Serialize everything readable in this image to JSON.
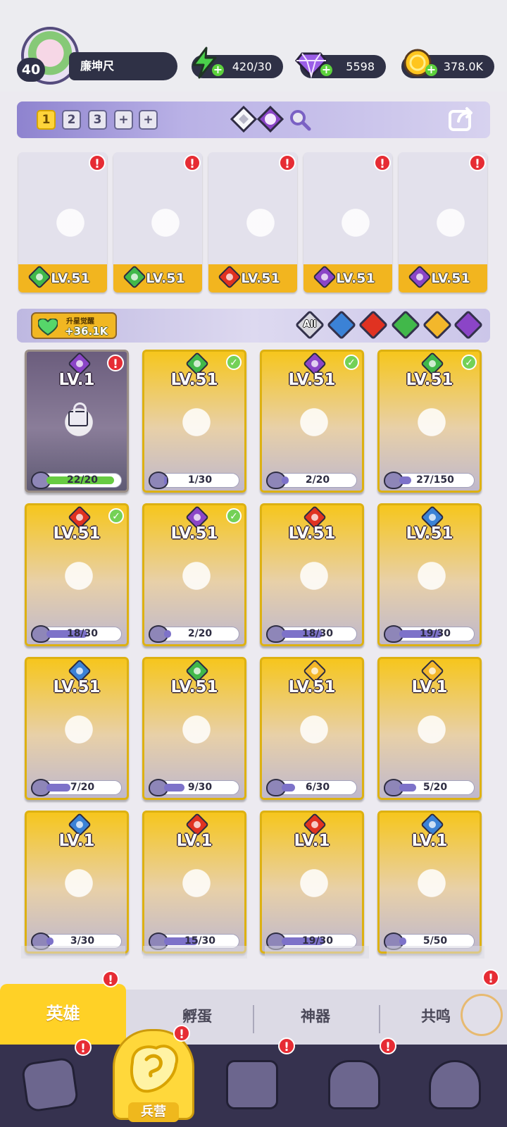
{
  "profile": {
    "level": "40",
    "name": "廉坤尺"
  },
  "resources": {
    "energy": "420/30",
    "gems": "5598",
    "coins": "378.0K"
  },
  "team": {
    "tabs": [
      "1",
      "2",
      "3",
      "+",
      "+"
    ],
    "active": "1"
  },
  "team_slots": [
    {
      "level": "LV.51",
      "element": "nature"
    },
    {
      "level": "LV.51",
      "element": "nature"
    },
    {
      "level": "LV.51",
      "element": "fire"
    },
    {
      "level": "LV.51",
      "element": "dark"
    },
    {
      "level": "LV.51",
      "element": "dark"
    }
  ],
  "awakening": {
    "title": "升星觉醒",
    "value": "+36.1K"
  },
  "filters": {
    "all": "All",
    "elements": [
      "water",
      "fire",
      "nature",
      "light",
      "dark"
    ]
  },
  "heroes": [
    {
      "level": "LV.1",
      "progress": "22/20",
      "fill": 1.0,
      "element": "dark",
      "locked": true,
      "alert": true,
      "check": false
    },
    {
      "level": "LV.51",
      "progress": "1/30",
      "fill": 0.03,
      "element": "nature",
      "locked": false,
      "alert": false,
      "check": true
    },
    {
      "level": "LV.51",
      "progress": "2/20",
      "fill": 0.1,
      "element": "dark",
      "locked": false,
      "alert": false,
      "check": true
    },
    {
      "level": "LV.51",
      "progress": "27/150",
      "fill": 0.18,
      "element": "nature",
      "locked": false,
      "alert": false,
      "check": true
    },
    {
      "level": "LV.51",
      "progress": "18/30",
      "fill": 0.6,
      "element": "fire",
      "locked": false,
      "alert": false,
      "check": true
    },
    {
      "level": "LV.51",
      "progress": "2/20",
      "fill": 0.1,
      "element": "dark",
      "locked": false,
      "alert": false,
      "check": true
    },
    {
      "level": "LV.51",
      "progress": "18/30",
      "fill": 0.6,
      "element": "fire",
      "locked": false,
      "alert": false,
      "check": false
    },
    {
      "level": "LV.51",
      "progress": "19/30",
      "fill": 0.63,
      "element": "water",
      "locked": false,
      "alert": false,
      "check": false
    },
    {
      "level": "LV.51",
      "progress": "7/20",
      "fill": 0.35,
      "element": "water",
      "locked": false,
      "alert": false,
      "check": false
    },
    {
      "level": "LV.51",
      "progress": "9/30",
      "fill": 0.3,
      "element": "nature",
      "locked": false,
      "alert": false,
      "check": false
    },
    {
      "level": "LV.51",
      "progress": "6/30",
      "fill": 0.2,
      "element": "light",
      "locked": false,
      "alert": false,
      "check": false
    },
    {
      "level": "LV.1",
      "progress": "5/20",
      "fill": 0.25,
      "element": "light",
      "locked": false,
      "alert": false,
      "check": false
    },
    {
      "level": "LV.1",
      "progress": "3/30",
      "fill": 0.1,
      "element": "water",
      "locked": false,
      "alert": false,
      "check": false
    },
    {
      "level": "LV.1",
      "progress": "15/30",
      "fill": 0.5,
      "element": "fire",
      "locked": false,
      "alert": false,
      "check": false
    },
    {
      "level": "LV.1",
      "progress": "19/30",
      "fill": 0.63,
      "element": "fire",
      "locked": false,
      "alert": false,
      "check": false
    },
    {
      "level": "LV.1",
      "progress": "5/50",
      "fill": 0.1,
      "element": "water",
      "locked": false,
      "alert": false,
      "check": false
    }
  ],
  "tabs": {
    "active": "英雄",
    "items": [
      "孵蛋",
      "神器",
      "共鸣"
    ]
  },
  "bottom_nav": {
    "active": "兵营"
  },
  "colors": {
    "gold": "#f2b51f",
    "water": "#3b82d6",
    "fire": "#e03221",
    "nature": "#41b84a",
    "light": "#f3b72b",
    "dark": "#8b45c7"
  }
}
